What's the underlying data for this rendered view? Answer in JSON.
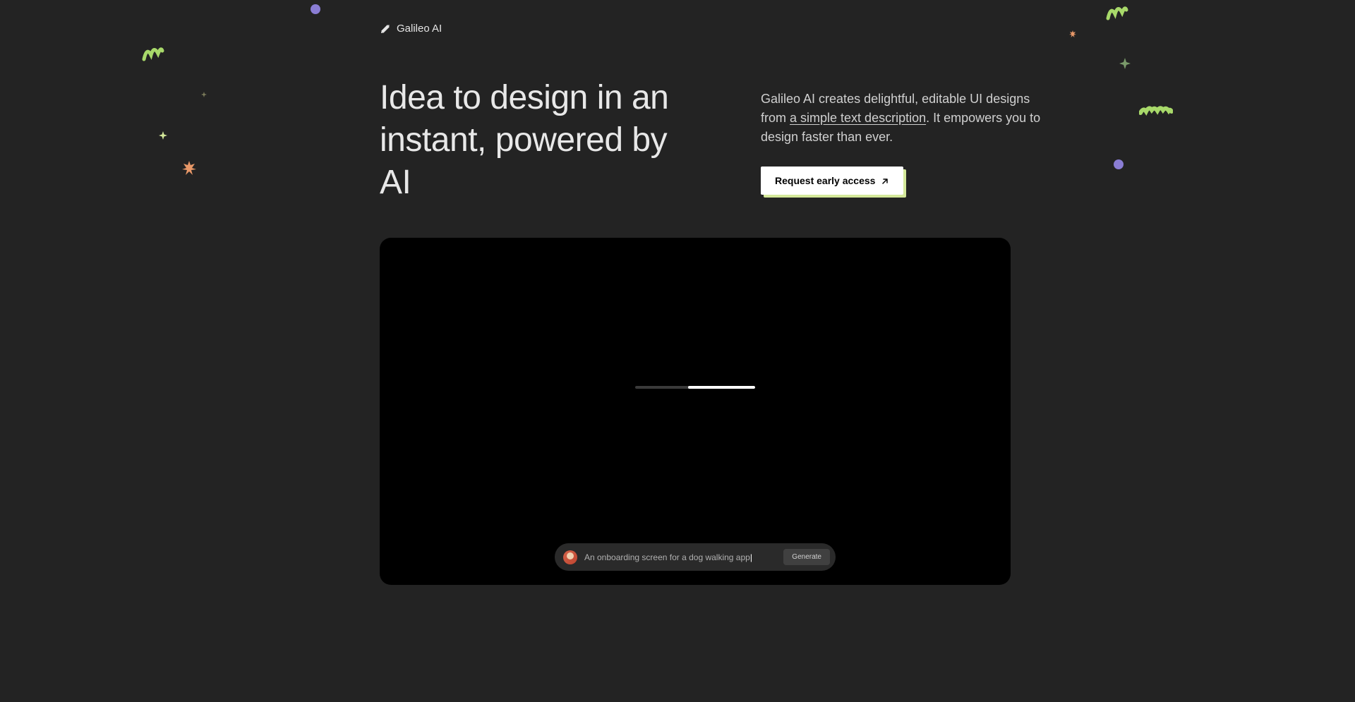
{
  "brand": {
    "name": "Galileo AI"
  },
  "hero": {
    "title": "Idea to design in an instant, powered by AI",
    "description_part1": "Galileo AI creates delightful, editable UI designs from ",
    "description_highlight": "a simple text description",
    "description_part2": ". It empowers you to design faster than ever."
  },
  "cta": {
    "label": "Request early access"
  },
  "demo": {
    "prompt_text": "An onboarding screen for a dog walking app",
    "generate_label": "Generate",
    "progress_percent": 56
  },
  "colors": {
    "bg": "#232323",
    "accent_green": "#a8d96a",
    "accent_purple": "#8a7dd4",
    "accent_orange": "#e89868",
    "cta_shadow": "#d4e89a"
  }
}
